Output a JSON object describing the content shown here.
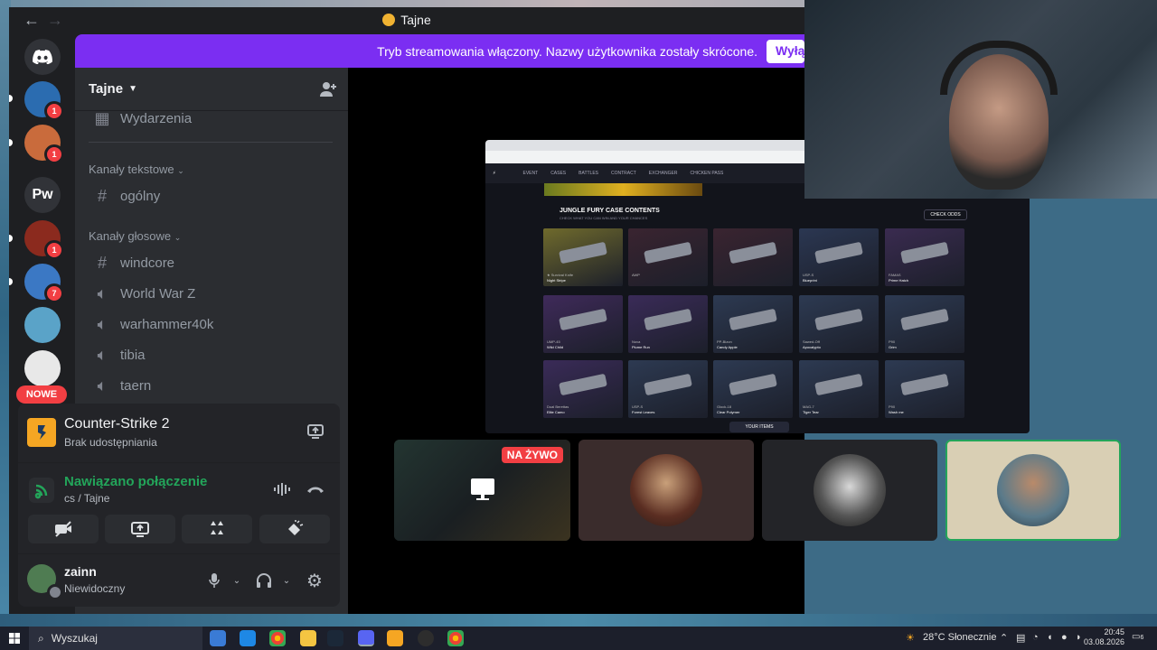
{
  "window": {
    "title": "Tajne",
    "back": "←",
    "forward": "→"
  },
  "banner": {
    "text": "Tryb streamowania włączony. Nazwy użytkownika zostały skrócone.",
    "button": "Wyłącz"
  },
  "servers": [
    {
      "label": "",
      "icon": "discord-icon",
      "color": "#5865f2"
    },
    {
      "label": "",
      "badge": "1",
      "color": "#2b6cb0"
    },
    {
      "label": "",
      "badge": "1",
      "color": "#c96b3c"
    },
    {
      "label": "Pw",
      "color": "#313338"
    },
    {
      "label": "",
      "badge": "1",
      "color": "#8b2a1e"
    },
    {
      "label": "",
      "badge": "7",
      "color": "#3b78c4"
    },
    {
      "label": "",
      "color": "#5aa3c8"
    },
    {
      "label": "",
      "color": "#e8e8e8"
    }
  ],
  "nowe_label": "NOWE",
  "guild": {
    "name": "Tajne"
  },
  "channels": {
    "events": "Wydarzenia",
    "text_category": "Kanały tekstowe",
    "text_channels": [
      "ogólny"
    ],
    "voice_category": "Kanały głosowe",
    "voice_channels": [
      {
        "name": "windcore",
        "icon": "hash"
      },
      {
        "name": "World War Z",
        "icon": "speaker"
      },
      {
        "name": "warhammer40k",
        "icon": "speaker"
      },
      {
        "name": "tibia",
        "icon": "speaker"
      },
      {
        "name": "taern",
        "icon": "speaker"
      }
    ]
  },
  "activity": {
    "game": "Counter-Strike 2",
    "status": "Brak udostępniania"
  },
  "connection": {
    "title": "Nawiązano połączenie",
    "subtitle": "cs / Tajne"
  },
  "user": {
    "name": "zainn",
    "status": "Niewidoczny"
  },
  "stream": {
    "site_nav": [
      "EVENT",
      "CASES",
      "BATTLES",
      "CONTRACT",
      "EXCHANGER",
      "CHICKEN PASS"
    ],
    "case_title": "JUNGLE FURY CASE CONTENTS",
    "case_subtitle": "CHECK WHAT YOU CAN WIN AND YOUR CHANCES",
    "check_odds": "CHECK ODDS",
    "your_items": "YOUR ITEMS",
    "skins": [
      {
        "name": "★ Survival Knife",
        "finish": "Night Stripe",
        "color": "#6f6a2c"
      },
      {
        "name": "AWP",
        "finish": "",
        "color": "#3a2430"
      },
      {
        "name": "",
        "finish": "",
        "color": "#3a2430"
      },
      {
        "name": "USP-S",
        "finish": "Blueprint",
        "color": "#2b3752"
      },
      {
        "name": "FAMAS",
        "finish": "Prime Hatch",
        "color": "#3a2b50"
      },
      {
        "name": "UMP-45",
        "finish": "Wild Child",
        "color": "#3f2a5a"
      },
      {
        "name": "Nova",
        "finish": "Plume Run",
        "color": "#3a2b58"
      },
      {
        "name": "PP-Bizon",
        "finish": "Candy Apple",
        "color": "#2d3a52"
      },
      {
        "name": "Sawed-Off",
        "finish": "Apocalypto",
        "color": "#2d3a52"
      },
      {
        "name": "P90",
        "finish": "Grim",
        "color": "#2d3a52"
      },
      {
        "name": "Dual Berettas",
        "finish": "Elite Camo",
        "color": "#3a2b58"
      },
      {
        "name": "USP-S",
        "finish": "Forest Leaves",
        "color": "#2d3a52"
      },
      {
        "name": "Glock-18",
        "finish": "Clear Polymer",
        "color": "#2d3a52"
      },
      {
        "name": "MAG-7",
        "finish": "Tiger Tear",
        "color": "#2d3a52"
      },
      {
        "name": "P90",
        "finish": "Wash me",
        "color": "#2d3a52"
      }
    ]
  },
  "tiles": {
    "live_label": "NA ŻYWO"
  },
  "taskbar": {
    "search": "Wyszukaj",
    "weather": "28°C Słonecznie",
    "time": "20:45",
    "date": "03.08.2026",
    "notifications": "6"
  }
}
